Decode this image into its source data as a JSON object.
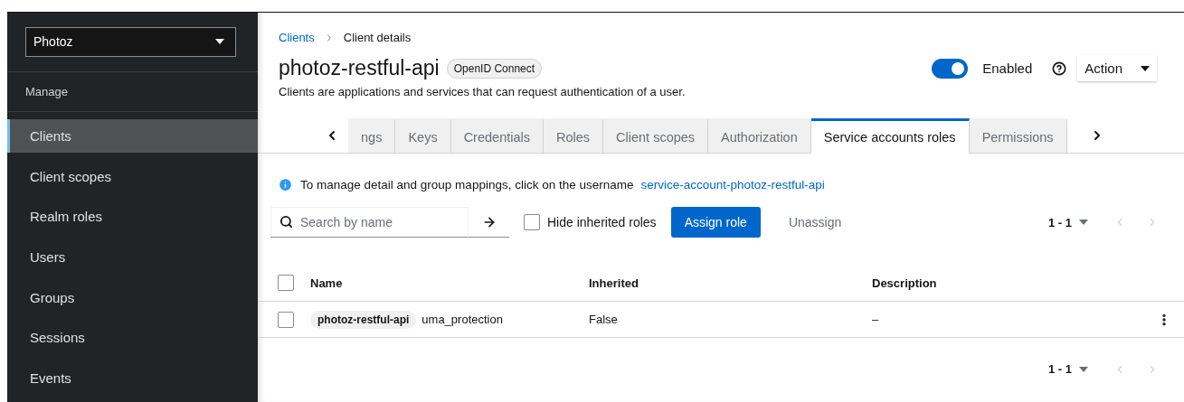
{
  "sidebar": {
    "realm": "Photoz",
    "section": "Manage",
    "items": [
      {
        "label": "Clients",
        "selected": true
      },
      {
        "label": "Client scopes",
        "selected": false
      },
      {
        "label": "Realm roles",
        "selected": false
      },
      {
        "label": "Users",
        "selected": false
      },
      {
        "label": "Groups",
        "selected": false
      },
      {
        "label": "Sessions",
        "selected": false
      },
      {
        "label": "Events",
        "selected": false
      }
    ]
  },
  "breadcrumb": {
    "link": "Clients",
    "current": "Client details"
  },
  "header": {
    "title": "photoz-restful-api",
    "protocol": "OpenID Connect",
    "description": "Clients are applications and services that can request authentication of a user.",
    "enabled": {
      "label": "Enabled",
      "on": true
    },
    "action": "Action"
  },
  "tabs": [
    {
      "label": "ngs",
      "selected": false
    },
    {
      "label": "Keys",
      "selected": false
    },
    {
      "label": "Credentials",
      "selected": false
    },
    {
      "label": "Roles",
      "selected": false
    },
    {
      "label": "Client scopes",
      "selected": false
    },
    {
      "label": "Authorization",
      "selected": false
    },
    {
      "label": "Service accounts roles",
      "selected": true
    },
    {
      "label": "Permissions",
      "selected": false
    }
  ],
  "info": {
    "text": "To manage detail and group mappings, click on the username",
    "link": "service-account-photoz-restful-api"
  },
  "toolbar": {
    "search": {
      "placeholder": "Search by name"
    },
    "hide_inherited": {
      "label": "Hide inherited roles",
      "checked": false
    },
    "assign": "Assign role",
    "unassign": "Unassign",
    "pagination": "1 - 1"
  },
  "table": {
    "columns": [
      "Name",
      "Inherited",
      "Description"
    ],
    "all_checked": false,
    "rows": [
      {
        "checked": false,
        "client": "photoz-restful-api",
        "role": "uma_protection",
        "inherited": "False",
        "description": "–"
      }
    ]
  },
  "footer_pagination": "1 - 1"
}
